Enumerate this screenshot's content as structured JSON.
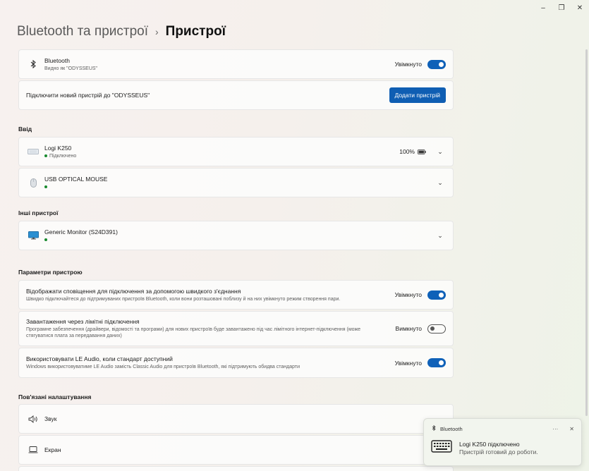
{
  "window": {
    "minimize": "–",
    "maximize": "❐",
    "close": "✕"
  },
  "breadcrumb": {
    "parent": "Bluetooth та пристрої",
    "separator": "›",
    "current": "Пристрої"
  },
  "bluetooth": {
    "title": "Bluetooth",
    "subtitle": "Видно як \"ODYSSEUS\"",
    "state": "Увімкнуто",
    "on": true
  },
  "add_device": {
    "text": "Підключити новий пристрій до \"ODYSSEUS\"",
    "button": "Додати пристрій"
  },
  "sections": {
    "input": "Ввід",
    "other": "Інші пристрої",
    "params": "Параметри пристрою",
    "related": "Пов'язані налаштування"
  },
  "input_devices": [
    {
      "name": "Logi K250",
      "status": "Підключено",
      "battery": "100%",
      "icon": "keyboard-icon"
    },
    {
      "name": "USB OPTICAL MOUSE",
      "status": "",
      "icon": "mouse-icon"
    }
  ],
  "other_devices": [
    {
      "name": "Generic Monitor (S24D391)",
      "status": "",
      "icon": "monitor-icon"
    }
  ],
  "settings": [
    {
      "title": "Відображати сповіщення для підключення за допомогою швидкого з'єднання",
      "desc": "Швидко підключайтеся до підтримуваних пристроїв Bluetooth, коли вони розташовані поблизу й на них увімкнуто режим створення пари.",
      "state": "Увімкнуто",
      "on": true
    },
    {
      "title": "Завантаження через лімітні підключення",
      "desc": "Програмне забезпечення (драйвери, відомості та програми) для нових пристроїв буде завантажено під час лімітного інтернет-підключення (може стягуватися плата за передавання даних)",
      "state": "Вимкнуто",
      "on": false
    },
    {
      "title": "Використовувати LE Audio, коли стандарт доступний",
      "desc": "Windows використовуватиме LE Audio замість Classic Audio для пристроїв Bluetooth, які підтримують обидва стандарти",
      "state": "Увімкнуто",
      "on": true
    }
  ],
  "related": [
    {
      "label": "Звук",
      "icon": "speaker-icon"
    },
    {
      "label": "Екран",
      "icon": "laptop-icon"
    }
  ],
  "toast": {
    "app": "Bluetooth",
    "more": "···",
    "close": "✕",
    "title": "Logi K250 підключено",
    "message": "Пристрій готовий до роботи."
  }
}
